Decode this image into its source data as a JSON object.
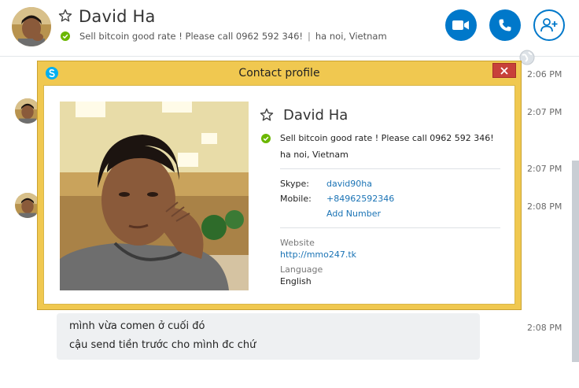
{
  "header": {
    "name": "David Ha",
    "mood": "Sell bitcoin good rate ! Please call 0962 592 346!",
    "separator": "|",
    "location": "ha noi, Vietnam"
  },
  "conversation": {
    "timestamps": [
      "2:06 PM",
      "2:07 PM",
      "2:07 PM",
      "2:08 PM",
      "2:08 PM"
    ],
    "messages": [
      "mình vừa comen ở cuối đó",
      "cậu send tiền trước cho mình đc chứ"
    ]
  },
  "dialog": {
    "title": "Contact profile",
    "name": "David Ha",
    "mood": "Sell bitcoin good rate ! Please call 0962 592 346!",
    "location": "ha noi, Vietnam",
    "skype_label": "Skype:",
    "skype_value": "david90ha",
    "mobile_label": "Mobile:",
    "mobile_value": "+84962592346",
    "add_number": "Add Number",
    "website_label": "Website",
    "website_value": "http://mmo247.tk",
    "language_label": "Language",
    "language_value": "English"
  },
  "colors": {
    "accent": "#0078ca",
    "dialog_frame": "#f0c850",
    "status_online": "#6bb700",
    "close_button": "#c8413a"
  },
  "icons": [
    "star-icon",
    "online-status-icon",
    "video-call-icon",
    "phone-icon",
    "add-contact-icon",
    "globe-icon",
    "skype-logo-icon",
    "close-icon"
  ]
}
